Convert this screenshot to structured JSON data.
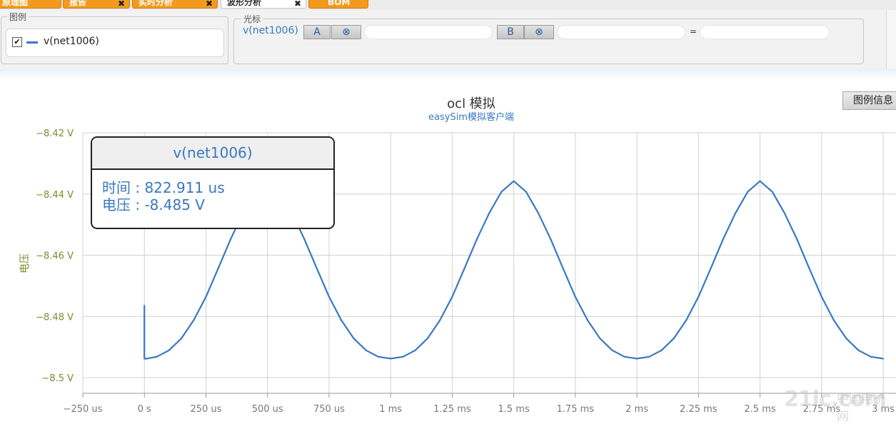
{
  "tabs": [
    {
      "label": "原理图",
      "closable": false,
      "active": false
    },
    {
      "label": "报告",
      "closable": true,
      "active": false
    },
    {
      "label": "实时分析",
      "closable": true,
      "active": false
    },
    {
      "label": "波形分析",
      "closable": true,
      "active": true
    },
    {
      "label": "BOM",
      "closable": false,
      "active": false
    }
  ],
  "legend_panel": {
    "title": "图例",
    "checked": true,
    "series_label": "v(net1006)"
  },
  "cursor_panel": {
    "title": "光标",
    "series_label": "v(net1006)",
    "button_a": "A",
    "button_clear_a": "⊗",
    "value_a": "",
    "button_b": "B",
    "button_clear_b": "⊗",
    "value_b": "",
    "equals": "=",
    "delta_value": ""
  },
  "legend_info_button": "图例信息",
  "tooltip": {
    "series": "v(net1006)",
    "time_line": "时间 : 822.911 us",
    "voltage_line": "电压 : -8.485 V"
  },
  "watermark": {
    "text": "21ic.com",
    "cn": "中国电子网"
  },
  "colors": {
    "series": "#3a78c0",
    "axis_label": "#7b8c2f",
    "tab": "#f39a1e"
  },
  "chart_data": {
    "type": "line",
    "title": "ocl 模拟",
    "subtitle": "easySim模拟客户端",
    "ylabel": "电压",
    "xlabel": "",
    "x_unit": "us",
    "xlim": [
      -250,
      3000
    ],
    "ylim": [
      -8.5,
      -8.42
    ],
    "x_ticks": [
      {
        "v": -250,
        "label": "−250 us"
      },
      {
        "v": 0,
        "label": "0 s"
      },
      {
        "v": 250,
        "label": "250 us"
      },
      {
        "v": 500,
        "label": "500 us"
      },
      {
        "v": 750,
        "label": "750 us"
      },
      {
        "v": 1000,
        "label": "1 ms"
      },
      {
        "v": 1250,
        "label": "1.25 ms"
      },
      {
        "v": 1500,
        "label": "1.5 ms"
      },
      {
        "v": 1750,
        "label": "1.75 ms"
      },
      {
        "v": 2000,
        "label": "2 ms"
      },
      {
        "v": 2250,
        "label": "2.25 ms"
      },
      {
        "v": 2500,
        "label": "2.5 ms"
      },
      {
        "v": 2750,
        "label": "2.75 ms"
      },
      {
        "v": 3000,
        "label": "3 ms"
      }
    ],
    "y_ticks": [
      {
        "v": -8.42,
        "label": "−8.42 V"
      },
      {
        "v": -8.44,
        "label": "−8.44 V"
      },
      {
        "v": -8.46,
        "label": "−8.46 V"
      },
      {
        "v": -8.48,
        "label": "−8.48 V"
      },
      {
        "v": -8.5,
        "label": "−8.5 V"
      }
    ],
    "grid": true,
    "series": [
      {
        "name": "v(net1006)",
        "x": [
          0,
          0,
          10,
          50,
          100,
          150,
          200,
          250,
          300,
          350,
          400,
          450,
          500,
          550,
          600,
          650,
          700,
          750,
          800,
          850,
          900,
          950,
          1000,
          1050,
          1100,
          1150,
          1200,
          1250,
          1300,
          1350,
          1400,
          1450,
          1500,
          1550,
          1600,
          1650,
          1700,
          1750,
          1800,
          1850,
          1900,
          1950,
          2000,
          2050,
          2100,
          2150,
          2200,
          2250,
          2300,
          2350,
          2400,
          2450,
          2500,
          2550,
          2600,
          2650,
          2700,
          2750,
          2800,
          2850,
          2900,
          2950,
          3000
        ],
        "y": [
          -8.4765,
          -8.4938,
          -8.4938,
          -8.4932,
          -8.4911,
          -8.4872,
          -8.4813,
          -8.4736,
          -8.4643,
          -8.4548,
          -8.4463,
          -8.4393,
          -8.4358,
          -8.4393,
          -8.4463,
          -8.4548,
          -8.4643,
          -8.4736,
          -8.4813,
          -8.4872,
          -8.4911,
          -8.4932,
          -8.4938,
          -8.4932,
          -8.4911,
          -8.4872,
          -8.4813,
          -8.4736,
          -8.4643,
          -8.4548,
          -8.4463,
          -8.4393,
          -8.4358,
          -8.4393,
          -8.4463,
          -8.4548,
          -8.4643,
          -8.4736,
          -8.4813,
          -8.4872,
          -8.4911,
          -8.4932,
          -8.4938,
          -8.4932,
          -8.4911,
          -8.4872,
          -8.4813,
          -8.4736,
          -8.4643,
          -8.4548,
          -8.4463,
          -8.4393,
          -8.4358,
          -8.4393,
          -8.4463,
          -8.4548,
          -8.4643,
          -8.4736,
          -8.4813,
          -8.4872,
          -8.4911,
          -8.4932,
          -8.4938
        ]
      }
    ]
  }
}
